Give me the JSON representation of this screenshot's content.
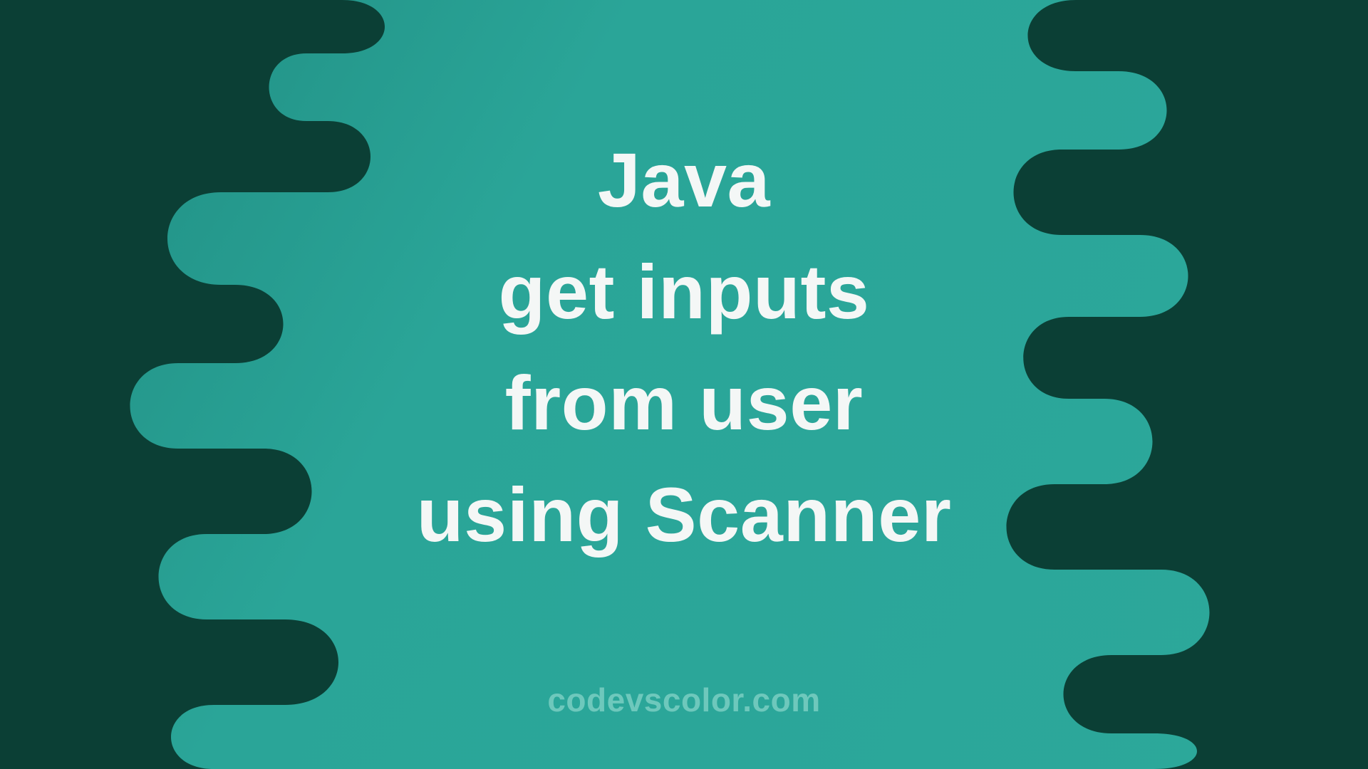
{
  "title": {
    "line1": "Java",
    "line2": "get inputs",
    "line3": "from user",
    "line4": "using Scanner"
  },
  "attribution": "codevscolor.com",
  "colors": {
    "bg_gradient_from": "#1f8a7f",
    "bg_gradient_to": "#2ca89b",
    "blob": "#0b3f35",
    "text": "#f4f7f6",
    "attribution": "#6ec8bc"
  }
}
